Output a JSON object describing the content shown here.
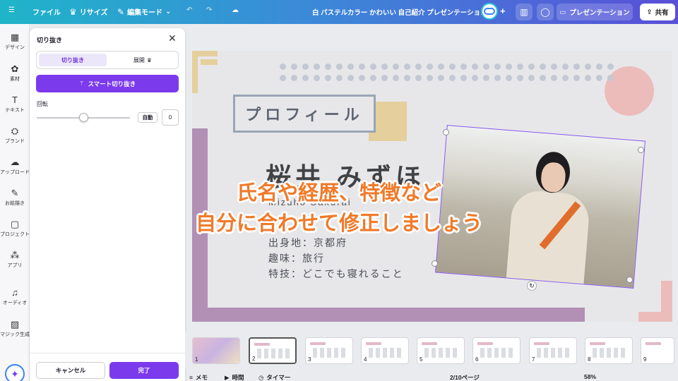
{
  "topbar": {
    "menu_icon": "hamburger-icon",
    "file_label": "ファイル",
    "resize_label": "リサイズ",
    "edit_mode_label": "編集モード",
    "doc_title": "白 パステルカラー かわいい 自己紹介 プレゼンテーション",
    "present_label": "プレゼンテーション",
    "share_label": "共有",
    "plus_label": "+"
  },
  "rail": {
    "items": [
      {
        "label": "デザイン",
        "icon": "design-icon"
      },
      {
        "label": "素材",
        "icon": "elements-icon"
      },
      {
        "label": "テキスト",
        "icon": "text-icon"
      },
      {
        "label": "ブランド",
        "icon": "brand-icon"
      },
      {
        "label": "アップロード",
        "icon": "upload-icon"
      },
      {
        "label": "お絵描き",
        "icon": "draw-icon"
      },
      {
        "label": "プロジェクト",
        "icon": "folder-icon"
      },
      {
        "label": "アプリ",
        "icon": "apps-icon"
      },
      {
        "label": "オーディオ",
        "icon": "audio-icon"
      },
      {
        "label": "マジック生成",
        "icon": "magic-media-icon"
      }
    ]
  },
  "panel": {
    "title": "切り抜き",
    "tab_crop": "切り抜き",
    "tab_expand": "展開",
    "smart_crop": "スマート切り抜き",
    "rotation_label": "回転",
    "auto_label": "自動",
    "rotation_value": "0",
    "rotation_level": 0.5,
    "cancel_label": "キャンセル",
    "done_label": "完了"
  },
  "slide": {
    "heading": "プロフィール",
    "name": "桜井 みずほ",
    "subname": "Mizuho Sakurai",
    "info": [
      "出身地：京都府",
      "趣味：旅行",
      "特技：どこでも寝れること"
    ],
    "colors": {
      "pink": "#ecbcba",
      "purple": "#b28fb5",
      "yellow": "#e5cf9c",
      "gray": "#9aa5b4",
      "accent": "#7c3aed"
    }
  },
  "caption": {
    "line1": "氏名や経歴、特徴など",
    "line2": "自分に合わせて修正しましょう",
    "color": "#f07a2a"
  },
  "thumbnails": [
    "1",
    "2",
    "3",
    "4",
    "5",
    "6",
    "7",
    "8",
    "9"
  ],
  "bottombar": {
    "notes": "メモ",
    "time": "時間",
    "timer": "タイマー",
    "page": "2/10ページ",
    "zoom": "58%"
  }
}
